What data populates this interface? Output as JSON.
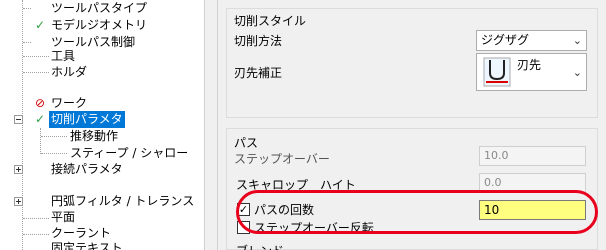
{
  "tree": {
    "items": [
      {
        "label": "ツールパスタイプ",
        "status": "none"
      },
      {
        "label": "モデルジオメトリ",
        "status": "check"
      },
      {
        "label": "ツールパス制御",
        "status": "none"
      },
      {
        "label": "工具",
        "status": "none"
      },
      {
        "label": "ホルダ",
        "status": "none"
      },
      {
        "label": "ワーク",
        "status": "ban"
      },
      {
        "label": "切削パラメタ",
        "status": "check",
        "selected": true,
        "expanded": true
      },
      {
        "label": "推移動作",
        "status": "none"
      },
      {
        "label": "スティープ / シャロー",
        "status": "none"
      },
      {
        "label": "接続パラメタ",
        "status": "none",
        "expander": "plus"
      },
      {
        "label": "円弧フィルタ / トレランス",
        "status": "none",
        "expander": "plus"
      },
      {
        "label": "平面",
        "status": "none"
      },
      {
        "label": "クーラント",
        "status": "none"
      },
      {
        "label": "固定テキスト",
        "status": "none"
      }
    ]
  },
  "cut_style": {
    "title": "切削スタイル",
    "method_label": "切削方法",
    "method_value": "ジグザグ",
    "comp_label": "刃先補正",
    "comp_value": "刃先"
  },
  "pass": {
    "title": "パス",
    "stepover_label": "ステップオーバー",
    "stepover_value": "10.0",
    "scallop_label": "スキャロップ　ハイト",
    "scallop_value": "0.0",
    "passes_label": "パスの回数",
    "passes_checked": true,
    "passes_value": "10",
    "reverse_label": "ステップオーバー反転",
    "reverse_checked": false
  },
  "next_group_title": "ブレンド",
  "colors": {
    "selection": "#0078d7",
    "highlight_ring": "#e8001c",
    "active_input": "#ffff7f",
    "check": "#2ea043",
    "ban": "#d40000"
  }
}
